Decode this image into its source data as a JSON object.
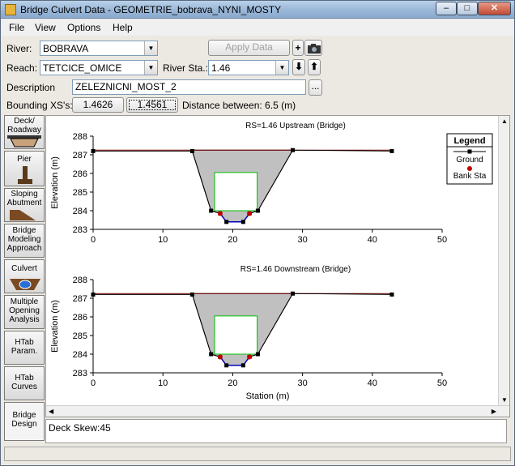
{
  "window": {
    "title": "Bridge Culvert Data - GEOMETRIE_bobrava_NYNI_MOSTY"
  },
  "menu": [
    "File",
    "View",
    "Options",
    "Help"
  ],
  "form": {
    "river_label": "River:",
    "river_value": "BOBRAVA",
    "reach_label": "Reach:",
    "reach_value": "TETCICE_OMICE",
    "river_sta_label": "River Sta.:",
    "river_sta_value": "1.46",
    "apply_label": "Apply Data",
    "description_label": "Description",
    "description_value": "ZELEZNICNI_MOST_2",
    "bounding_label": "Bounding XS's:",
    "bounding_up": "1.4626",
    "bounding_down": "1.4561",
    "distance_text": "Distance between: 6.5 (m)"
  },
  "sidebar": [
    {
      "label": "Deck/ Roadway",
      "icon": "deck-icon"
    },
    {
      "label": "Pier",
      "icon": "pier-icon"
    },
    {
      "label": "Sloping Abutment",
      "icon": "abutment-icon"
    },
    {
      "label": "Bridge Modeling Approach",
      "icon": "none"
    },
    {
      "label": "Culvert",
      "icon": "culvert-icon"
    },
    {
      "label": "Multiple Opening Analysis",
      "icon": "none"
    },
    {
      "label": "HTab Param.",
      "icon": "none"
    },
    {
      "label": "HTab Curves",
      "icon": "none"
    },
    {
      "label": "Bridge Design",
      "icon": "none"
    }
  ],
  "status_text": "Deck Skew:45",
  "colors": {
    "ground": "#000000",
    "deck_fill": "#c0c0c0",
    "opening": "#00c000",
    "water": "#0000c0",
    "bank": "#c00000",
    "wse": "#800000"
  },
  "chart_data": [
    {
      "type": "line",
      "title": "RS=1.46   Upstream  (Bridge)",
      "ylabel": "Elevation (m)",
      "xlabel": "",
      "xlim": [
        0,
        50
      ],
      "ylim": [
        283,
        288
      ],
      "xticks": [
        0,
        10,
        20,
        30,
        40,
        50
      ],
      "yticks": [
        283,
        284,
        285,
        286,
        287,
        288
      ],
      "series": [
        {
          "name": "Ground",
          "points": [
            [
              0,
              287.2
            ],
            [
              14.2,
              287.2
            ],
            [
              16.9,
              284.0
            ],
            [
              18.2,
              283.85
            ],
            [
              19.1,
              283.4
            ],
            [
              21.5,
              283.4
            ],
            [
              22.4,
              283.85
            ],
            [
              23.6,
              284.0
            ],
            [
              28.6,
              287.25
            ],
            [
              42.8,
              287.2
            ]
          ]
        },
        {
          "name": "Bank Sta",
          "points": [
            [
              18.2,
              283.85
            ],
            [
              22.4,
              283.85
            ]
          ]
        }
      ],
      "deck": {
        "x_left": 14.2,
        "x_right": 28.6,
        "top": 287.25
      },
      "opening": {
        "x_left": 17.4,
        "x_right": 23.5,
        "top": 286.05,
        "bottom": 284.0
      }
    },
    {
      "type": "line",
      "title": "RS=1.46   Downstream  (Bridge)",
      "ylabel": "Elevation (m)",
      "xlabel": "Station (m)",
      "xlim": [
        0,
        50
      ],
      "ylim": [
        283,
        288
      ],
      "xticks": [
        0,
        10,
        20,
        30,
        40,
        50
      ],
      "yticks": [
        283,
        284,
        285,
        286,
        287,
        288
      ],
      "series": [
        {
          "name": "Ground",
          "points": [
            [
              0,
              287.2
            ],
            [
              14.2,
              287.2
            ],
            [
              16.9,
              284.0
            ],
            [
              18.2,
              283.85
            ],
            [
              19.1,
              283.4
            ],
            [
              21.5,
              283.4
            ],
            [
              22.4,
              283.85
            ],
            [
              23.6,
              284.0
            ],
            [
              28.6,
              287.25
            ],
            [
              42.8,
              287.2
            ]
          ]
        },
        {
          "name": "Bank Sta",
          "points": [
            [
              18.2,
              283.85
            ],
            [
              22.4,
              283.85
            ]
          ]
        }
      ],
      "deck": {
        "x_left": 14.2,
        "x_right": 28.6,
        "top": 287.25
      },
      "opening": {
        "x_left": 17.4,
        "x_right": 23.5,
        "top": 286.05,
        "bottom": 284.0
      }
    }
  ],
  "legend": {
    "title": "Legend",
    "items": [
      "Ground",
      "Bank Sta"
    ]
  }
}
